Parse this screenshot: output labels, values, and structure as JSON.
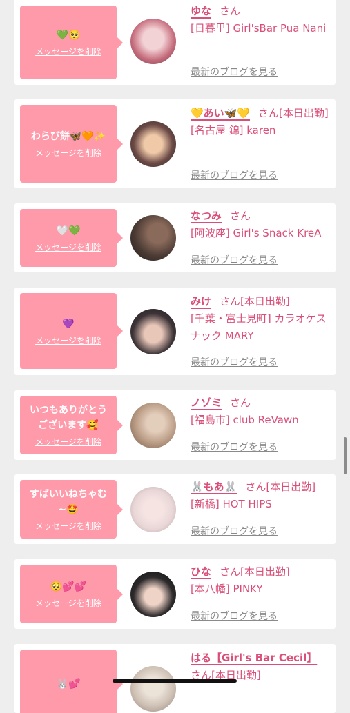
{
  "labels": {
    "delete_message": "メッセージを削除",
    "latest_blog": "最新のブログを見る"
  },
  "messages": [
    {
      "message": "💚🥺",
      "name": "ゆな",
      "suffix": "さん",
      "shop": "[日暮里] Girl'sBar Pua Nani",
      "avatar_color": "#c56c7c"
    },
    {
      "message": "わらび餅🦋🧡✨",
      "name": "💛あい🦋💛",
      "suffix": "さん[本日出勤]",
      "shop": "[名古屋 錦] karen",
      "avatar_color": "#6b4a46"
    },
    {
      "message": "🤍💚",
      "name": "なつみ",
      "suffix": "さん",
      "shop": "[阿波座] Girl's Snack KreA",
      "avatar_color": "#4a3a34"
    },
    {
      "message": "💜",
      "name": "みけ",
      "suffix": "さん[本日出勤]",
      "shop": "[千葉・富士見町] カラオケスナック MARY",
      "avatar_color": "#3d3438"
    },
    {
      "message": "いつもありがとう\nございます🥰",
      "name": "ノゾミ",
      "suffix": "さん",
      "shop": "[福島市] club ReVawn",
      "avatar_color": "#b89a83"
    },
    {
      "message": "すばいいねちゃむ\n~🤩",
      "name": "🐰もあ🐰",
      "suffix": "さん[本日出勤]",
      "shop": "[新橋] HOT HIPS",
      "avatar_color": "#e9d7d8"
    },
    {
      "message": "🥺💕💕",
      "name": "ひな",
      "suffix": "さん[本日出勤]",
      "shop": "[本八幡] PINKY",
      "avatar_color": "#2d2a2c"
    },
    {
      "message": "🐰💕",
      "name": "はる【Girl's Bar Cecil】",
      "suffix": "さん[本日出勤]",
      "shop": "",
      "avatar_color": "#cdbfb3"
    }
  ]
}
